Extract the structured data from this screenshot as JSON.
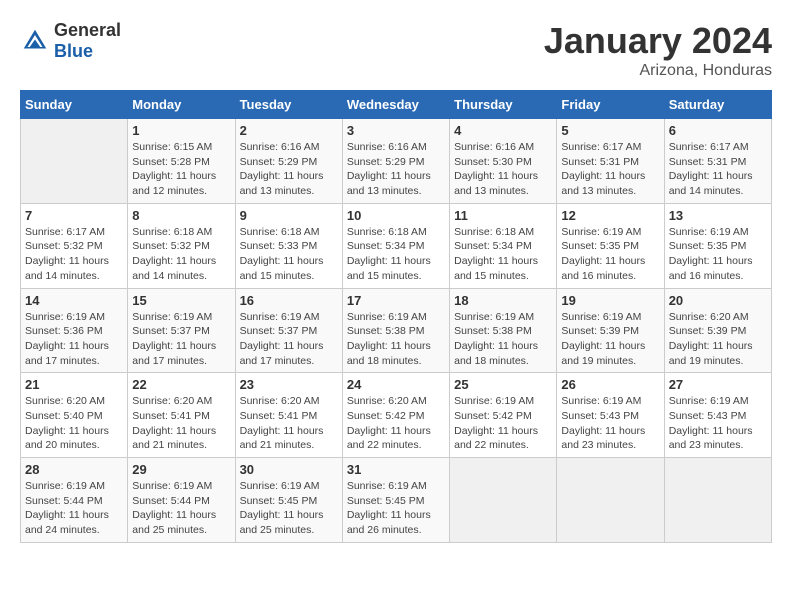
{
  "header": {
    "logo_general": "General",
    "logo_blue": "Blue",
    "main_title": "January 2024",
    "subtitle": "Arizona, Honduras"
  },
  "calendar": {
    "days_of_week": [
      "Sunday",
      "Monday",
      "Tuesday",
      "Wednesday",
      "Thursday",
      "Friday",
      "Saturday"
    ],
    "weeks": [
      [
        {
          "day": "",
          "info": ""
        },
        {
          "day": "1",
          "info": "Sunrise: 6:15 AM\nSunset: 5:28 PM\nDaylight: 11 hours\nand 12 minutes."
        },
        {
          "day": "2",
          "info": "Sunrise: 6:16 AM\nSunset: 5:29 PM\nDaylight: 11 hours\nand 13 minutes."
        },
        {
          "day": "3",
          "info": "Sunrise: 6:16 AM\nSunset: 5:29 PM\nDaylight: 11 hours\nand 13 minutes."
        },
        {
          "day": "4",
          "info": "Sunrise: 6:16 AM\nSunset: 5:30 PM\nDaylight: 11 hours\nand 13 minutes."
        },
        {
          "day": "5",
          "info": "Sunrise: 6:17 AM\nSunset: 5:31 PM\nDaylight: 11 hours\nand 13 minutes."
        },
        {
          "day": "6",
          "info": "Sunrise: 6:17 AM\nSunset: 5:31 PM\nDaylight: 11 hours\nand 14 minutes."
        }
      ],
      [
        {
          "day": "7",
          "info": "Sunrise: 6:17 AM\nSunset: 5:32 PM\nDaylight: 11 hours\nand 14 minutes."
        },
        {
          "day": "8",
          "info": "Sunrise: 6:18 AM\nSunset: 5:32 PM\nDaylight: 11 hours\nand 14 minutes."
        },
        {
          "day": "9",
          "info": "Sunrise: 6:18 AM\nSunset: 5:33 PM\nDaylight: 11 hours\nand 15 minutes."
        },
        {
          "day": "10",
          "info": "Sunrise: 6:18 AM\nSunset: 5:34 PM\nDaylight: 11 hours\nand 15 minutes."
        },
        {
          "day": "11",
          "info": "Sunrise: 6:18 AM\nSunset: 5:34 PM\nDaylight: 11 hours\nand 15 minutes."
        },
        {
          "day": "12",
          "info": "Sunrise: 6:19 AM\nSunset: 5:35 PM\nDaylight: 11 hours\nand 16 minutes."
        },
        {
          "day": "13",
          "info": "Sunrise: 6:19 AM\nSunset: 5:35 PM\nDaylight: 11 hours\nand 16 minutes."
        }
      ],
      [
        {
          "day": "14",
          "info": "Sunrise: 6:19 AM\nSunset: 5:36 PM\nDaylight: 11 hours\nand 17 minutes."
        },
        {
          "day": "15",
          "info": "Sunrise: 6:19 AM\nSunset: 5:37 PM\nDaylight: 11 hours\nand 17 minutes."
        },
        {
          "day": "16",
          "info": "Sunrise: 6:19 AM\nSunset: 5:37 PM\nDaylight: 11 hours\nand 17 minutes."
        },
        {
          "day": "17",
          "info": "Sunrise: 6:19 AM\nSunset: 5:38 PM\nDaylight: 11 hours\nand 18 minutes."
        },
        {
          "day": "18",
          "info": "Sunrise: 6:19 AM\nSunset: 5:38 PM\nDaylight: 11 hours\nand 18 minutes."
        },
        {
          "day": "19",
          "info": "Sunrise: 6:19 AM\nSunset: 5:39 PM\nDaylight: 11 hours\nand 19 minutes."
        },
        {
          "day": "20",
          "info": "Sunrise: 6:20 AM\nSunset: 5:39 PM\nDaylight: 11 hours\nand 19 minutes."
        }
      ],
      [
        {
          "day": "21",
          "info": "Sunrise: 6:20 AM\nSunset: 5:40 PM\nDaylight: 11 hours\nand 20 minutes."
        },
        {
          "day": "22",
          "info": "Sunrise: 6:20 AM\nSunset: 5:41 PM\nDaylight: 11 hours\nand 21 minutes."
        },
        {
          "day": "23",
          "info": "Sunrise: 6:20 AM\nSunset: 5:41 PM\nDaylight: 11 hours\nand 21 minutes."
        },
        {
          "day": "24",
          "info": "Sunrise: 6:20 AM\nSunset: 5:42 PM\nDaylight: 11 hours\nand 22 minutes."
        },
        {
          "day": "25",
          "info": "Sunrise: 6:19 AM\nSunset: 5:42 PM\nDaylight: 11 hours\nand 22 minutes."
        },
        {
          "day": "26",
          "info": "Sunrise: 6:19 AM\nSunset: 5:43 PM\nDaylight: 11 hours\nand 23 minutes."
        },
        {
          "day": "27",
          "info": "Sunrise: 6:19 AM\nSunset: 5:43 PM\nDaylight: 11 hours\nand 23 minutes."
        }
      ],
      [
        {
          "day": "28",
          "info": "Sunrise: 6:19 AM\nSunset: 5:44 PM\nDaylight: 11 hours\nand 24 minutes."
        },
        {
          "day": "29",
          "info": "Sunrise: 6:19 AM\nSunset: 5:44 PM\nDaylight: 11 hours\nand 25 minutes."
        },
        {
          "day": "30",
          "info": "Sunrise: 6:19 AM\nSunset: 5:45 PM\nDaylight: 11 hours\nand 25 minutes."
        },
        {
          "day": "31",
          "info": "Sunrise: 6:19 AM\nSunset: 5:45 PM\nDaylight: 11 hours\nand 26 minutes."
        },
        {
          "day": "",
          "info": ""
        },
        {
          "day": "",
          "info": ""
        },
        {
          "day": "",
          "info": ""
        }
      ]
    ]
  }
}
